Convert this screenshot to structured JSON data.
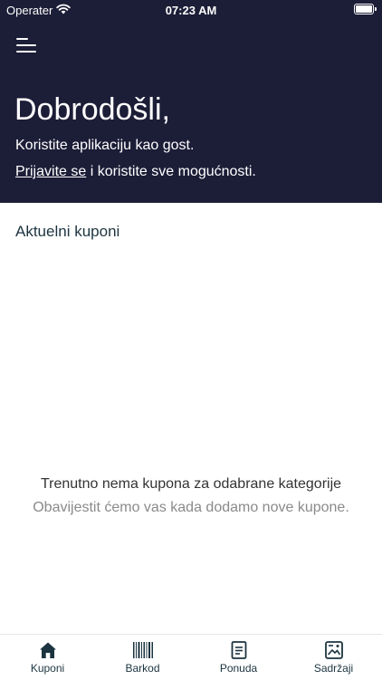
{
  "status_bar": {
    "carrier": "Operater",
    "time": "07:23 AM"
  },
  "header": {
    "title": "Dobrodošli,",
    "guest_text": "Koristite aplikaciju kao gost.",
    "login_link": "Prijavite se",
    "login_rest": " i koristite sve mogućnosti."
  },
  "main": {
    "section_title": "Aktuelni kuponi",
    "empty_title": "Trenutno nema kupona za odabrane kategorije",
    "empty_subtitle": "Obavijestit ćemo vas kada dodamo nove kupone."
  },
  "tabs": [
    {
      "label": "Kuponi",
      "icon": "home-icon"
    },
    {
      "label": "Barkod",
      "icon": "barcode-icon"
    },
    {
      "label": "Ponuda",
      "icon": "document-icon"
    },
    {
      "label": "Sadržaji",
      "icon": "gallery-icon"
    }
  ],
  "colors": {
    "header_bg": "#1c1d37",
    "accent": "#1c3440"
  }
}
